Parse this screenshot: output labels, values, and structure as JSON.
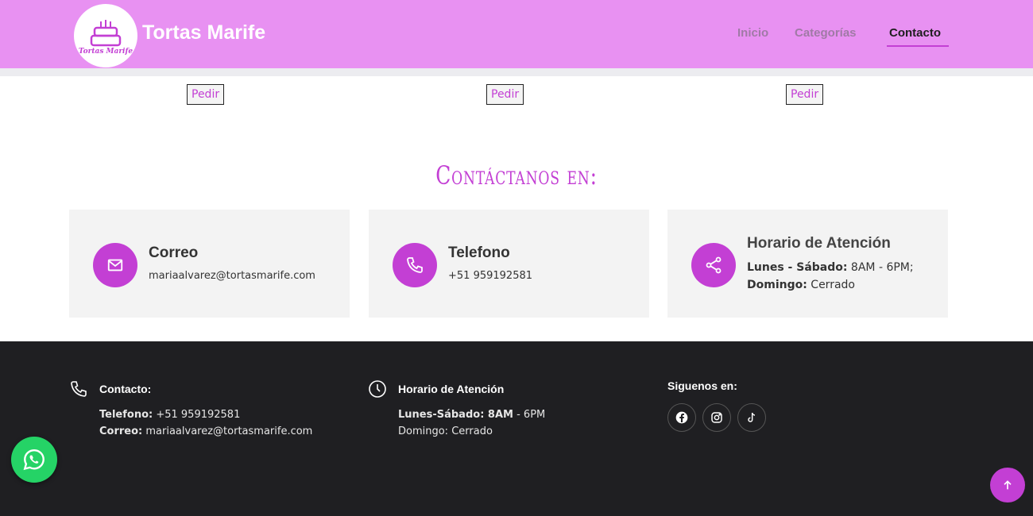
{
  "header": {
    "brand": "Tortas Marife",
    "logo_text": "Tortas Marife",
    "nav": [
      {
        "label": "Inicio"
      },
      {
        "label": "Categorías"
      },
      {
        "label": "Contacto"
      }
    ]
  },
  "products": {
    "order_labels": [
      "Pedir",
      "Pedir",
      "Pedir"
    ]
  },
  "contact": {
    "title": "Contáctanos en:",
    "cards": [
      {
        "title": "Correo",
        "text": "mariaalvarez@tortasmarife.com",
        "icon": "envelope-icon"
      },
      {
        "title": "Telefono",
        "text": "+51 959192581",
        "icon": "phone-icon"
      },
      {
        "title": "Horario de Atención",
        "line1_bold": "Lunes - Sábado:",
        "line1": " 8AM - 6PM;",
        "line2_bold": "Domingo:",
        "line2": " Cerrado",
        "icon": "share-icon"
      }
    ]
  },
  "footer": {
    "contact": {
      "title": "Contacto:",
      "phone_label": "Telefono:",
      "phone": " +51 959192581",
      "email_label": "Correo:",
      "email": " mariaalvarez@tortasmarife.com"
    },
    "hours": {
      "title": "Horario de Atención",
      "line1_bold": "Lunes-Sábado: 8AM",
      "line1": " - 6PM",
      "line2": "Domingo: Cerrado"
    },
    "social": {
      "title": "Siguenos en:",
      "icons": [
        "facebook-icon",
        "instagram-icon",
        "tiktok-icon"
      ]
    }
  },
  "colors": {
    "header_bg": "#e891f2",
    "accent": "#c33fd4",
    "footer_bg": "#1f1f22",
    "whatsapp": "#25d366"
  }
}
